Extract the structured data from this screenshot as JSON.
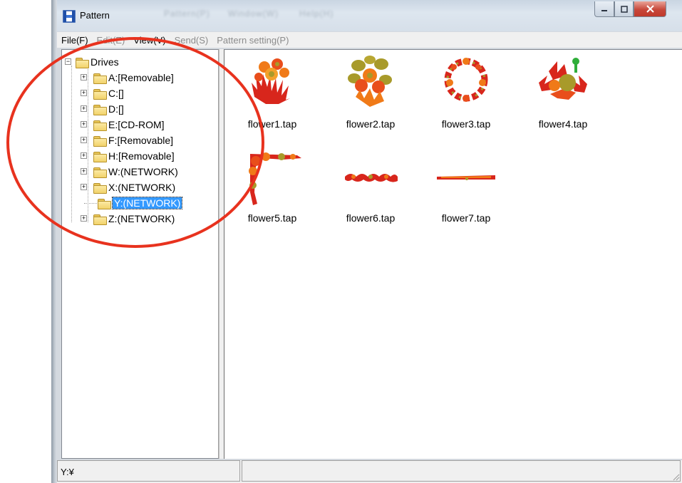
{
  "window": {
    "title": "Pattern",
    "blurred_title_extras": [
      "Pattern(P)",
      "Window(W)",
      "Help(H)"
    ]
  },
  "menu": [
    {
      "label": "File(F)",
      "enabled": true
    },
    {
      "label": "Edit(E)",
      "enabled": false
    },
    {
      "label": "View(V)",
      "enabled": true
    },
    {
      "label": "Send(S)",
      "enabled": false
    },
    {
      "label": "Pattern setting(P)",
      "enabled": false
    }
  ],
  "tree": {
    "root": "Drives",
    "drives": [
      {
        "label": "A:[Removable]",
        "expandable": true,
        "selected": false
      },
      {
        "label": "C:[]",
        "expandable": true,
        "selected": false
      },
      {
        "label": "D:[]",
        "expandable": true,
        "selected": false
      },
      {
        "label": "E:[CD-ROM]",
        "expandable": true,
        "selected": false
      },
      {
        "label": "F:[Removable]",
        "expandable": true,
        "selected": false
      },
      {
        "label": "H:[Removable]",
        "expandable": true,
        "selected": false
      },
      {
        "label": "W:(NETWORK)",
        "expandable": true,
        "selected": false
      },
      {
        "label": "X:(NETWORK)",
        "expandable": true,
        "selected": false
      },
      {
        "label": "Y:(NETWORK)",
        "expandable": false,
        "selected": true
      },
      {
        "label": "Z:(NETWORK)",
        "expandable": true,
        "selected": false
      }
    ]
  },
  "files": [
    {
      "name": "flower1.tap",
      "thumbnail": "flower-bouquet-icon"
    },
    {
      "name": "flower2.tap",
      "thumbnail": "flower-cluster-icon"
    },
    {
      "name": "flower3.tap",
      "thumbnail": "flower-wreath-icon"
    },
    {
      "name": "flower4.tap",
      "thumbnail": "flower-leaves-icon"
    },
    {
      "name": "flower5.tap",
      "thumbnail": "flower-corner-icon"
    },
    {
      "name": "flower6.tap",
      "thumbnail": "flower-border-icon"
    },
    {
      "name": "flower7.tap",
      "thumbnail": "flower-line-icon"
    }
  ],
  "status": {
    "path": "Y:¥",
    "secondary": ""
  },
  "colors": {
    "annotation": "#e8321e",
    "selection": "#3399ff",
    "flower_red": "#d8261c",
    "flower_orange": "#f07a18",
    "flower_olive": "#a89a2a"
  }
}
